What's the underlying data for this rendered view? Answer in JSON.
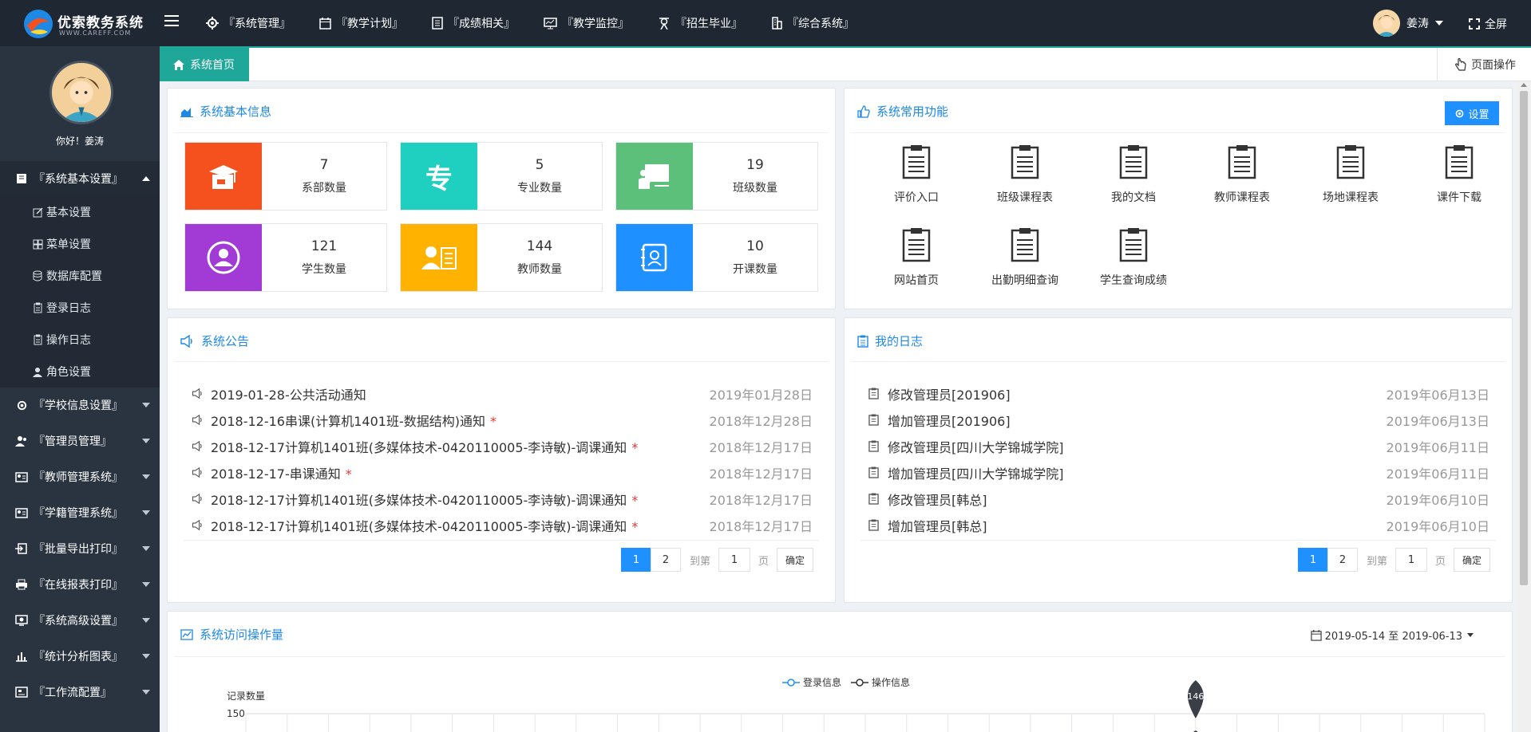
{
  "app": {
    "title": "优索教务系统",
    "subtitle": "WWW.CAREFF.COM"
  },
  "topnav": [
    {
      "label": "『系统管理』",
      "icon": "gear-icon"
    },
    {
      "label": "『教学计划』",
      "icon": "calendar-icon"
    },
    {
      "label": "『成绩相关』",
      "icon": "list-icon"
    },
    {
      "label": "『教学监控』",
      "icon": "monitor-icon"
    },
    {
      "label": "『招生毕业』",
      "icon": "graduate-icon"
    },
    {
      "label": "『综合系统』",
      "icon": "building-icon"
    }
  ],
  "user": {
    "name": "姜涛",
    "greeting": "你好！姜涛"
  },
  "fullscreen_label": "全屏",
  "sidebar": {
    "groups": [
      {
        "label": "『系统基本设置』",
        "expanded": true
      },
      {
        "label": "『学校信息设置』"
      },
      {
        "label": "『管理员管理』"
      },
      {
        "label": "『教师管理系统』"
      },
      {
        "label": "『学籍管理系统』"
      },
      {
        "label": "『批量导出打印』"
      },
      {
        "label": "『在线报表打印』"
      },
      {
        "label": "『系统高级设置』"
      },
      {
        "label": "『统计分析图表』"
      },
      {
        "label": "『工作流配置』"
      }
    ],
    "subitems": [
      {
        "label": "基本设置"
      },
      {
        "label": "菜单设置"
      },
      {
        "label": "数据库配置"
      },
      {
        "label": "登录日志"
      },
      {
        "label": "操作日志"
      },
      {
        "label": "角色设置"
      }
    ]
  },
  "tabs": {
    "home": "系统首页",
    "page_ops": "页面操作"
  },
  "basic_info": {
    "title": "系统基本信息",
    "stats": [
      {
        "value": "7",
        "label": "系部数量",
        "color": "#f4511e"
      },
      {
        "value": "5",
        "label": "专业数量",
        "color": "#1fcfbf",
        "glyph": "专"
      },
      {
        "value": "19",
        "label": "班级数量",
        "color": "#5cbf7a"
      },
      {
        "value": "121",
        "label": "学生数量",
        "color": "#a23bd6"
      },
      {
        "value": "144",
        "label": "教师数量",
        "color": "#ffb300"
      },
      {
        "value": "10",
        "label": "开课数量",
        "color": "#1e90ff"
      }
    ]
  },
  "common_functions": {
    "title": "系统常用功能",
    "settings_label": "设置",
    "items": [
      {
        "label": "评价入口"
      },
      {
        "label": "班级课程表"
      },
      {
        "label": "我的文档"
      },
      {
        "label": "教师课程表"
      },
      {
        "label": "场地课程表"
      },
      {
        "label": "课件下载"
      },
      {
        "label": "网站首页"
      },
      {
        "label": "出勤明细查询"
      },
      {
        "label": "学生查询成绩"
      }
    ]
  },
  "notices": {
    "title": "系统公告",
    "items": [
      {
        "text": "2019-01-28-公共活动通知",
        "date": "2019年01月28日",
        "star": ""
      },
      {
        "text": "2018-12-16串课(计算机1401班-数据结构)通知",
        "date": "2018年12月28日",
        "star": "*"
      },
      {
        "text": "2018-12-17计算机1401班(多媒体技术-0420110005-李诗敏)-调课通知",
        "date": "2018年12月17日",
        "star": "*"
      },
      {
        "text": "2018-12-17-串课通知",
        "date": "2018年12月17日",
        "star": "*"
      },
      {
        "text": "2018-12-17计算机1401班(多媒体技术-0420110005-李诗敏)-调课通知",
        "date": "2018年12月17日",
        "star": "*"
      },
      {
        "text": "2018-12-17计算机1401班(多媒体技术-0420110005-李诗敏)-调课通知",
        "date": "2018年12月17日",
        "star": "*"
      }
    ],
    "pager": {
      "pages": [
        "1",
        "2"
      ],
      "current": "1",
      "goto_label": "到第",
      "input_value": "1",
      "page_label": "页",
      "confirm_label": "确定"
    }
  },
  "my_log": {
    "title": "我的日志",
    "items": [
      {
        "text": "修改管理员[201906]",
        "date": "2019年06月13日"
      },
      {
        "text": "增加管理员[201906]",
        "date": "2019年06月13日"
      },
      {
        "text": "修改管理员[四川大学锦城学院]",
        "date": "2019年06月11日"
      },
      {
        "text": "增加管理员[四川大学锦城学院]",
        "date": "2019年06月11日"
      },
      {
        "text": "修改管理员[韩总]",
        "date": "2019年06月10日"
      },
      {
        "text": "增加管理员[韩总]",
        "date": "2019年06月10日"
      }
    ],
    "pager": {
      "pages": [
        "1",
        "2"
      ],
      "current": "1",
      "goto_label": "到第",
      "input_value": "1",
      "page_label": "页",
      "confirm_label": "确定"
    }
  },
  "visits": {
    "title": "系统访问操作量",
    "date_range": "2019-05-14 至 2019-06-13",
    "legend": [
      "登录信息",
      "操作信息"
    ],
    "y_axis_label": "记录数量",
    "y_top_tick": "150",
    "peak_label": "146"
  },
  "chart_data": {
    "type": "line",
    "title": "",
    "series": [
      {
        "name": "登录信息",
        "color": "#1e90ff"
      },
      {
        "name": "操作信息",
        "color": "#333333"
      }
    ],
    "ylabel": "记录数量",
    "yticks_visible": [
      "150"
    ],
    "max_point_label": "146"
  }
}
